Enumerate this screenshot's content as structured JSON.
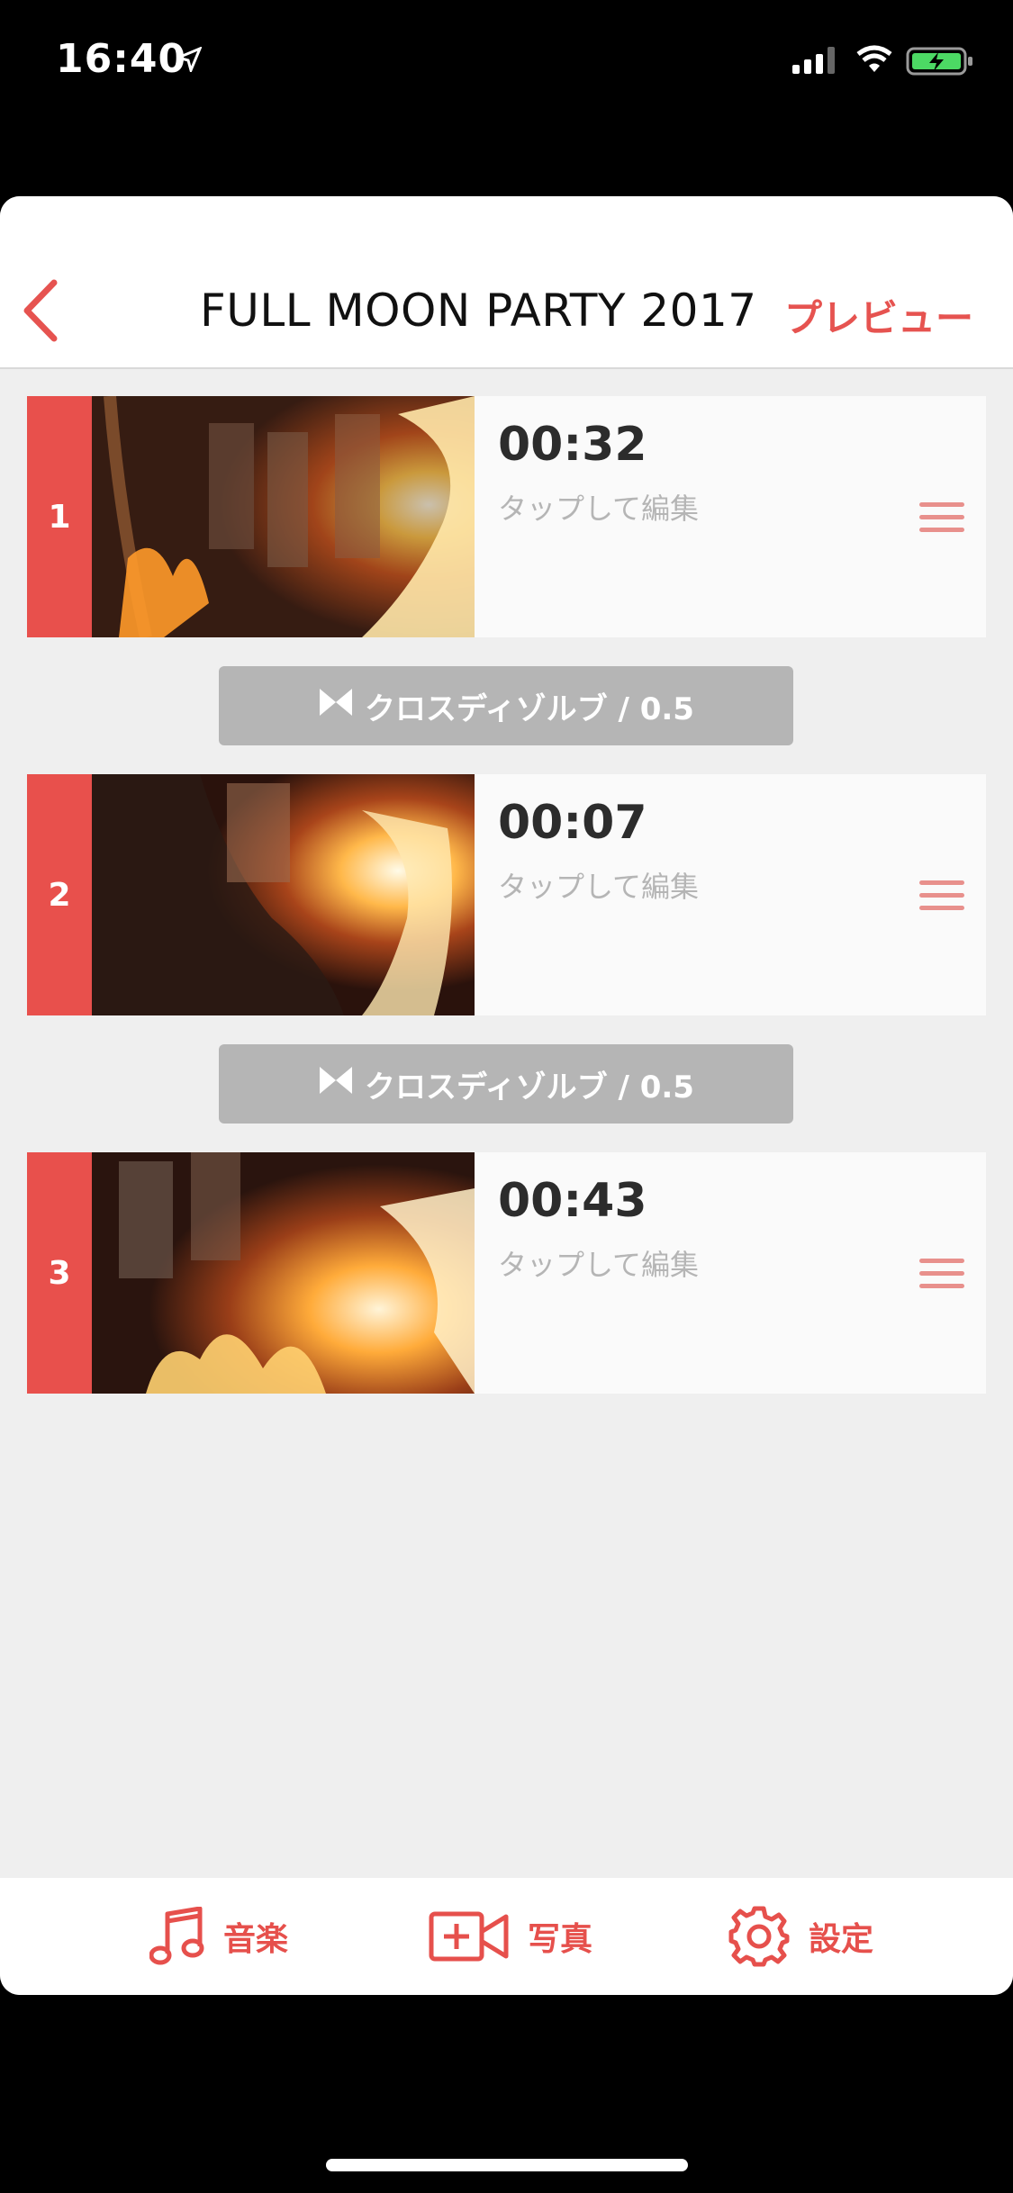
{
  "status": {
    "time": "16:40"
  },
  "nav": {
    "title": "FULL MOON PARTY 2017",
    "preview_label": "プレビュー"
  },
  "clips": [
    {
      "index": "1",
      "duration": "00:32",
      "hint": "タップして編集"
    },
    {
      "index": "2",
      "duration": "00:07",
      "hint": "タップして編集"
    },
    {
      "index": "3",
      "duration": "00:43",
      "hint": "タップして編集"
    }
  ],
  "transitions": [
    {
      "label": "クロスディゾルブ / 0.5"
    },
    {
      "label": "クロスディゾルブ / 0.5"
    }
  ],
  "tabbar": {
    "music": "音楽",
    "photo": "写真",
    "settings": "設定"
  },
  "colors": {
    "accent": "#e8504c",
    "transition_bg": "#b5b5b5",
    "background": "#efefef"
  },
  "icons": [
    "location-arrow-icon",
    "signal-icon",
    "wifi-icon",
    "battery-charging-icon",
    "back-chevron-icon",
    "drag-handle-icon",
    "crossfade-icon",
    "music-note-icon",
    "add-video-icon",
    "gear-icon"
  ]
}
